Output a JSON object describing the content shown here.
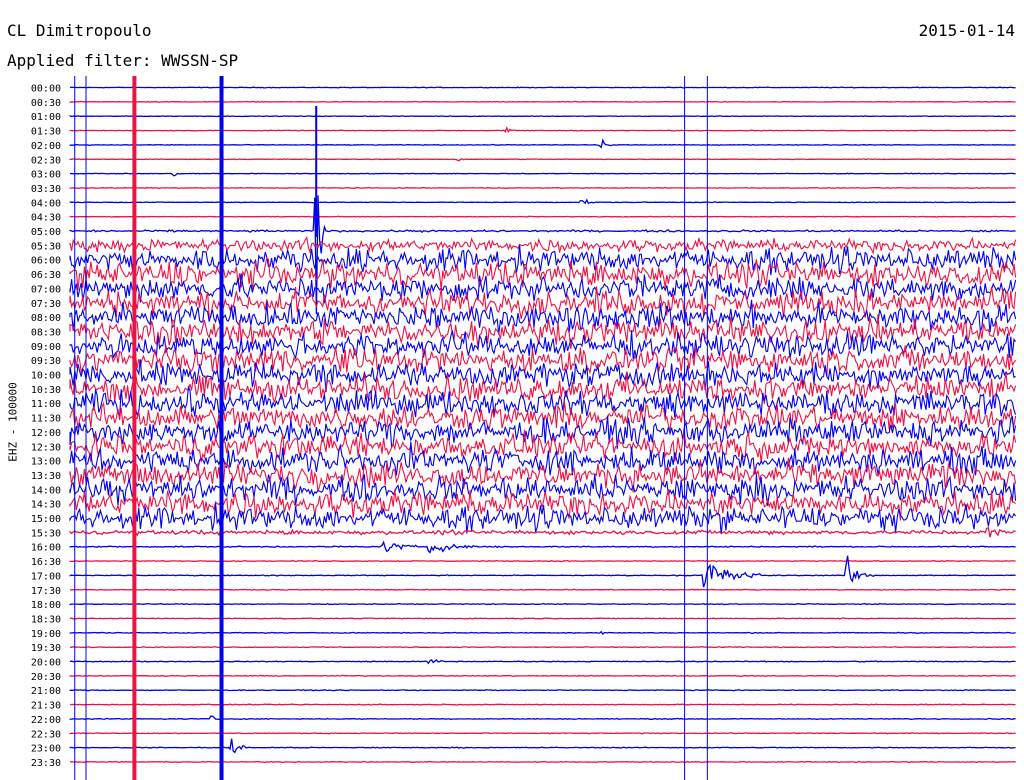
{
  "station": "CL Dimitropoulo",
  "filter_text": "Applied filter: WWSSN-SP",
  "date": "2015-01-14",
  "channel": "EHZ - 100000",
  "colors": {
    "trace_a": "#0000ee",
    "trace_b": "#ee1144",
    "background": "#ffffff",
    "text": "#000000"
  },
  "chart_data": {
    "type": "helicorder",
    "row_interval_minutes": 30,
    "time_labels": [
      "00:00",
      "00:30",
      "01:00",
      "01:30",
      "02:00",
      "02:30",
      "03:00",
      "03:30",
      "04:00",
      "04:30",
      "05:00",
      "05:30",
      "06:00",
      "06:30",
      "07:00",
      "07:30",
      "08:00",
      "08:30",
      "09:00",
      "09:30",
      "10:00",
      "10:30",
      "11:00",
      "11:30",
      "12:00",
      "12:30",
      "13:00",
      "13:30",
      "14:00",
      "14:30",
      "15:00",
      "15:30",
      "16:00",
      "16:30",
      "17:00",
      "17:30",
      "18:00",
      "18:30",
      "19:00",
      "19:30",
      "20:00",
      "20:30",
      "21:00",
      "21:30",
      "22:00",
      "22:30",
      "23:00",
      "23:30"
    ],
    "row_colors": [
      "blue",
      "red"
    ],
    "noise_level": [
      0.3,
      0.3,
      0.3,
      0.3,
      0.3,
      0.3,
      0.3,
      0.3,
      0.3,
      0.3,
      0.9,
      6,
      11,
      12,
      12,
      12,
      12,
      12,
      12,
      12,
      12,
      12,
      12,
      12,
      12,
      12,
      12,
      12,
      12,
      12,
      11,
      2,
      0.6,
      0.4,
      0.4,
      0.4,
      0.4,
      0.4,
      0.4,
      0.4,
      0.4,
      0.4,
      0.4,
      0.4,
      0.4,
      0.4,
      0.4,
      0.4
    ],
    "events": [
      {
        "row": 3,
        "at": 0.46,
        "amplitude": 4,
        "duration": 0.01
      },
      {
        "row": 4,
        "at": 0.56,
        "amplitude": 8,
        "duration": 0.02
      },
      {
        "row": 5,
        "at": 0.41,
        "amplitude": 3,
        "duration": 0.01
      },
      {
        "row": 6,
        "at": 0.11,
        "amplitude": 3,
        "duration": 0.01
      },
      {
        "row": 8,
        "at": 0.54,
        "amplitude": 4,
        "duration": 0.02
      },
      {
        "row": 10,
        "at": 0.26,
        "amplitude": 125,
        "duration": 0.01
      },
      {
        "row": 31,
        "at": 0.97,
        "amplitude": 6,
        "duration": 0.02
      },
      {
        "row": 32,
        "at": 0.33,
        "amplitude": 10,
        "duration": 0.04
      },
      {
        "row": 32,
        "at": 0.38,
        "amplitude": 9,
        "duration": 0.05
      },
      {
        "row": 34,
        "at": 0.67,
        "amplitude": 30,
        "duration": 0.06
      },
      {
        "row": 34,
        "at": 0.82,
        "amplitude": 20,
        "duration": 0.03
      },
      {
        "row": 38,
        "at": 0.56,
        "amplitude": 5,
        "duration": 0.01
      },
      {
        "row": 40,
        "at": 0.38,
        "amplitude": 5,
        "duration": 0.02
      },
      {
        "row": 44,
        "at": 0.15,
        "amplitude": 6,
        "duration": 0.01
      },
      {
        "row": 46,
        "at": 0.17,
        "amplitude": 14,
        "duration": 0.02
      }
    ],
    "vertical_lines": [
      {
        "at": 0.0,
        "color": "blue",
        "weight": "thin"
      },
      {
        "at": 0.005,
        "color": "blue",
        "weight": "thin"
      },
      {
        "at": 0.068,
        "color": "red",
        "weight": "thick"
      },
      {
        "at": 0.16,
        "color": "blue",
        "weight": "thick"
      },
      {
        "at": 0.649,
        "color": "blue",
        "weight": "thin"
      },
      {
        "at": 0.673,
        "color": "blue",
        "weight": "thin"
      }
    ]
  }
}
